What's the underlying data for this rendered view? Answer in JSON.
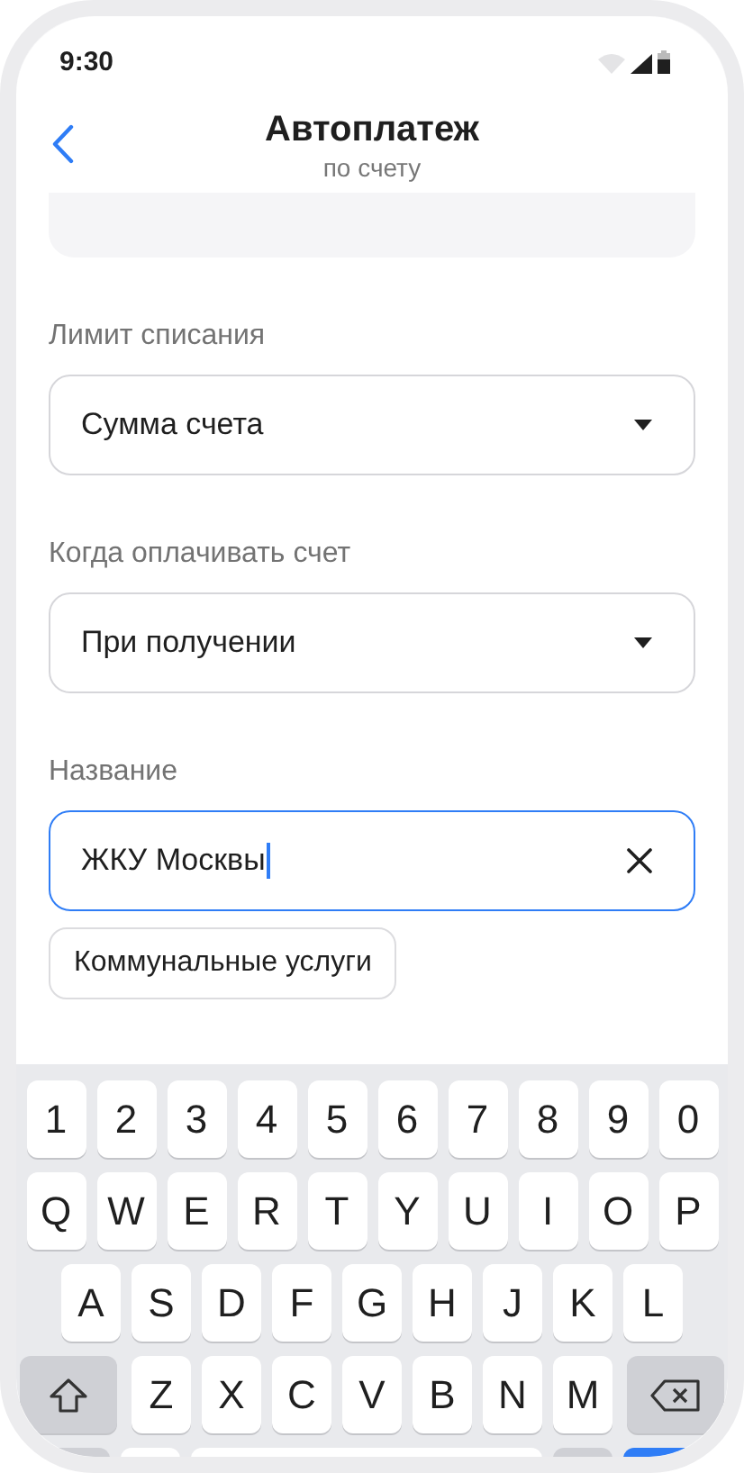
{
  "status_bar": {
    "time": "9:30"
  },
  "header": {
    "title": "Автоплатеж",
    "subtitle": "по счету"
  },
  "fields": [
    {
      "kind": "select",
      "label": "Лимит списания",
      "value": "Сумма счета",
      "focused": false
    },
    {
      "kind": "select",
      "label": "Когда оплачивать счет",
      "value": "При получении",
      "focused": false
    },
    {
      "kind": "text",
      "label": "Название",
      "value": "ЖКУ Москвы",
      "focused": true
    }
  ],
  "suggestions": [
    {
      "label": "Коммунальные услуги"
    }
  ],
  "keyboard": {
    "rows": [
      [
        "1",
        "2",
        "3",
        "4",
        "5",
        "6",
        "7",
        "8",
        "9",
        "0"
      ],
      [
        "Q",
        "W",
        "E",
        "R",
        "T",
        "Y",
        "U",
        "I",
        "O",
        "P"
      ],
      [
        "A",
        "S",
        "D",
        "F",
        "G",
        "H",
        "J",
        "K",
        "L"
      ],
      [
        "Z",
        "X",
        "C",
        "V",
        "B",
        "N",
        "M"
      ]
    ]
  }
}
